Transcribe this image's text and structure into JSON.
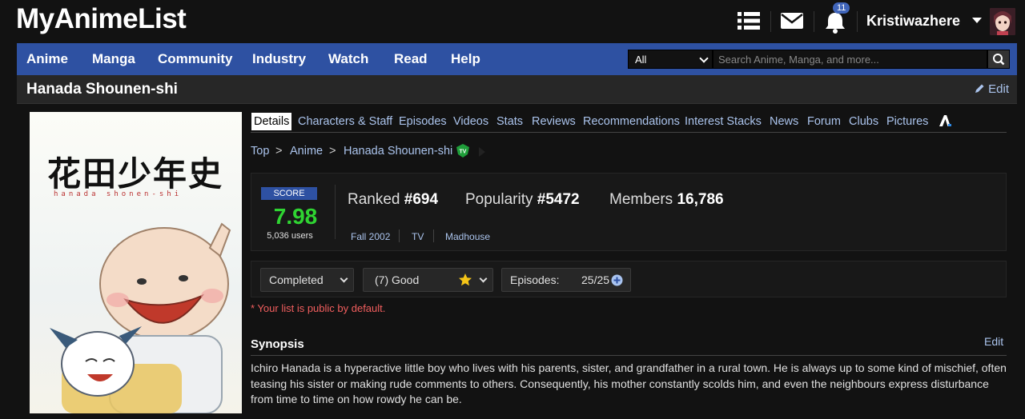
{
  "site": {
    "logo": "MyAnimeList"
  },
  "header": {
    "notification_count": "11",
    "username": "Kristiwazhere"
  },
  "nav": {
    "items": [
      "Anime",
      "Manga",
      "Community",
      "Industry",
      "Watch",
      "Read",
      "Help"
    ],
    "search_scope": "All",
    "search_placeholder": "Search Anime, Manga, and more..."
  },
  "title_bar": {
    "title": "Hanada Shounen-shi",
    "edit_label": "Edit"
  },
  "cover": {
    "title": "花田少年史",
    "subtitle": "hanada shonen-shi"
  },
  "tabs": [
    "Details",
    "Characters & Staff",
    "Episodes",
    "Videos",
    "Stats",
    "Reviews",
    "Recommendations",
    "Interest Stacks",
    "News",
    "Forum",
    "Clubs",
    "Pictures"
  ],
  "breadcrumb": {
    "top": "Top",
    "sep": ">",
    "section": "Anime",
    "current": "Hanada Shounen-shi",
    "badge": "TV"
  },
  "score": {
    "label": "SCORE",
    "value": "7.98",
    "users": "5,036 users",
    "ranked_label": "Ranked",
    "ranked": "#694",
    "popularity_label": "Popularity",
    "popularity": "#5472",
    "members_label": "Members",
    "members": "16,786",
    "season": "Fall 2002",
    "type": "TV",
    "studio": "Madhouse"
  },
  "list": {
    "status": "Completed",
    "rating": "(7) Good",
    "episodes_label": "Episodes:",
    "episodes": "25/25",
    "public_note": "* Your list is public by default."
  },
  "synopsis": {
    "heading": "Synopsis",
    "edit_label": "Edit",
    "text": "Ichiro Hanada is a hyperactive little boy who lives with his parents, sister, and grandfather in a rural town. He is always up to some kind of mischief, often teasing his sister or making rude comments to others. Consequently, his mother constantly scolds him, and even the neighbours express disturbance from time to time on how rowdy he can be."
  },
  "colors": {
    "nav_blue": "#2e51a2",
    "link": "#abc4ed",
    "score_green": "#2fd432",
    "note_red": "#f15e5e"
  }
}
